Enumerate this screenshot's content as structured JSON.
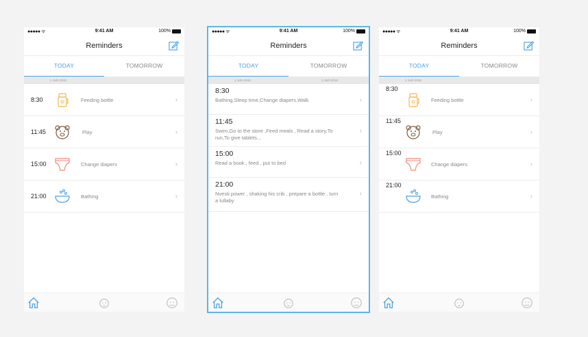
{
  "status": {
    "signal": "●●●●● ᯤ",
    "time": "9:41 AM",
    "battery": "100%"
  },
  "nav": {
    "title": "Reminders"
  },
  "tabs": {
    "today": "TODAY",
    "tomorrow": "TOMORROW"
  },
  "dates": {
    "today": "1 JUN 2018",
    "tomorrow": "2 JUN 2018"
  },
  "phone1": {
    "items": [
      {
        "time": "8:30",
        "label": "Feeding bottle",
        "icon": "bottle-icon"
      },
      {
        "time": "11:45",
        "label": "Play",
        "icon": "bear-icon"
      },
      {
        "time": "15:00",
        "label": "Change diapers",
        "icon": "diaper-icon"
      },
      {
        "time": "21:00",
        "label": "Bathing",
        "icon": "bath-icon"
      }
    ]
  },
  "phone2": {
    "items": [
      {
        "time": "8:30",
        "desc": "Bathing,Sleep time,Change diapers,Walk"
      },
      {
        "time": "11:45",
        "desc": "Swim,Go to the store ,Feed meals , Read a story,To run,To give tablets..."
      },
      {
        "time": "15:00",
        "desc": "Read a book , feed , put to bed"
      },
      {
        "time": "21:00",
        "desc": "Nvesti power , shaking his crib , prepare a bottle , turn a lullaby"
      }
    ]
  },
  "phone3": {
    "items": [
      {
        "time": "8:30",
        "label": "Feeding bottle",
        "icon": "bottle-icon"
      },
      {
        "time": "11:45",
        "label": "Play",
        "icon": "bear-icon"
      },
      {
        "time": "15:00",
        "label": "Change diapers",
        "icon": "diaper-icon"
      },
      {
        "time": "21:00",
        "label": "Bathing",
        "icon": "bath-icon"
      }
    ]
  },
  "colors": {
    "accent": "#4a9fe0",
    "selection": "#5ab6e6",
    "bottle": "#f2b84b",
    "bear": "#7a5a3a",
    "diaper": "#f08a78",
    "bath": "#4a9fe0"
  }
}
